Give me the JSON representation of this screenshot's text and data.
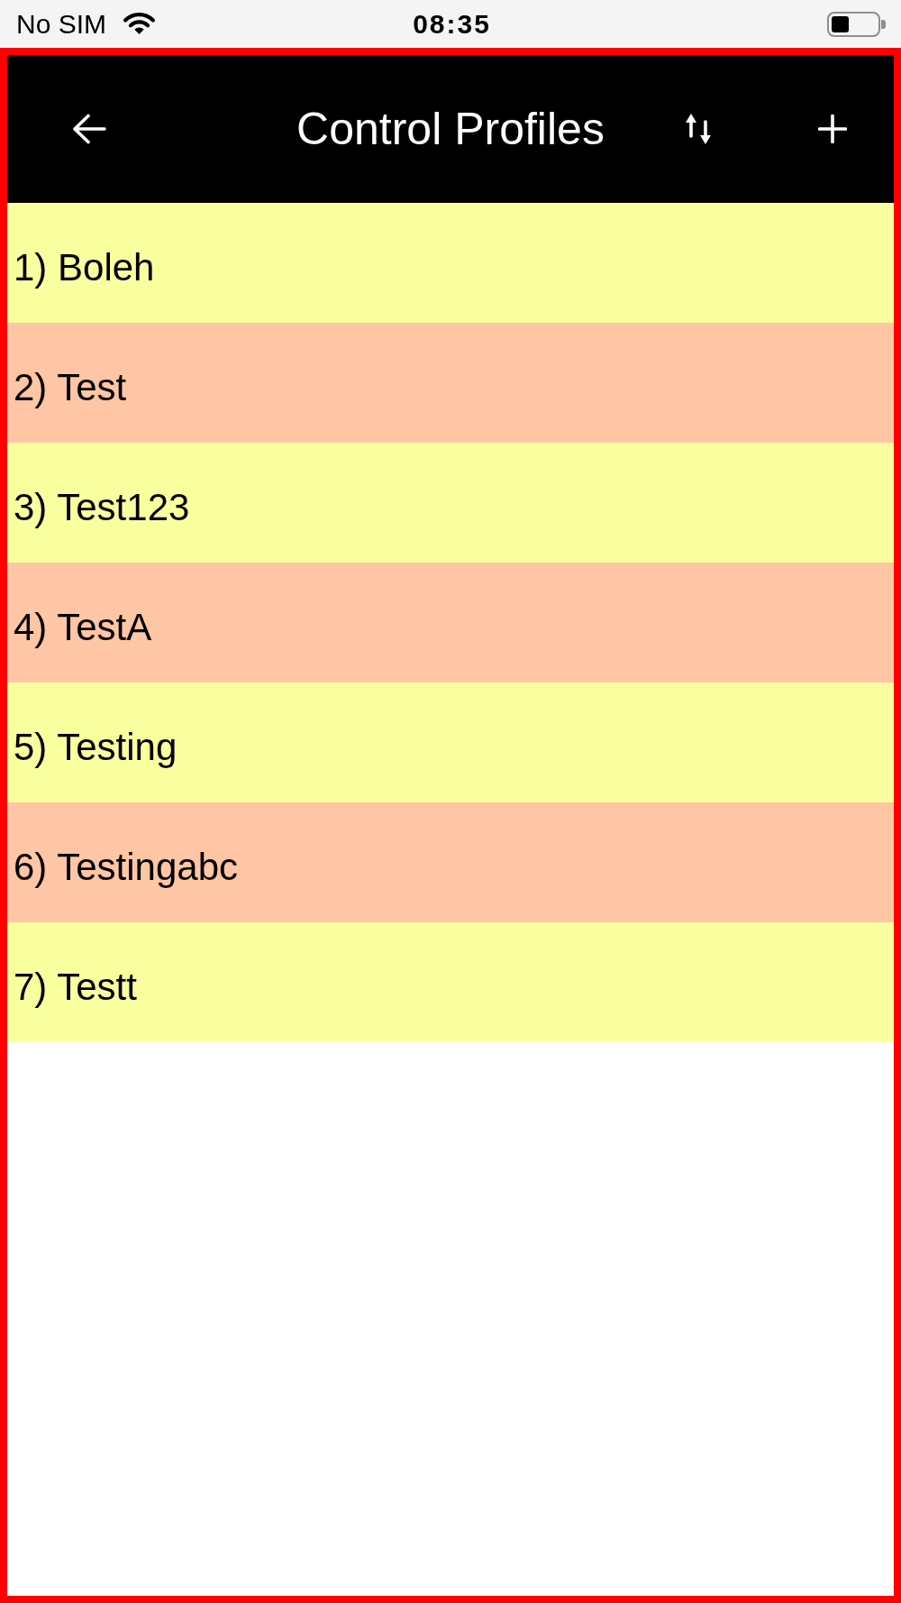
{
  "status_bar": {
    "carrier": "No SIM",
    "time": "08:35"
  },
  "header": {
    "title": "Control Profiles"
  },
  "profiles": [
    "1) Boleh",
    "2) Test",
    "3) Test123",
    "4) TestA",
    "5) Testing",
    "6) Testingabc",
    "7) Testt"
  ]
}
